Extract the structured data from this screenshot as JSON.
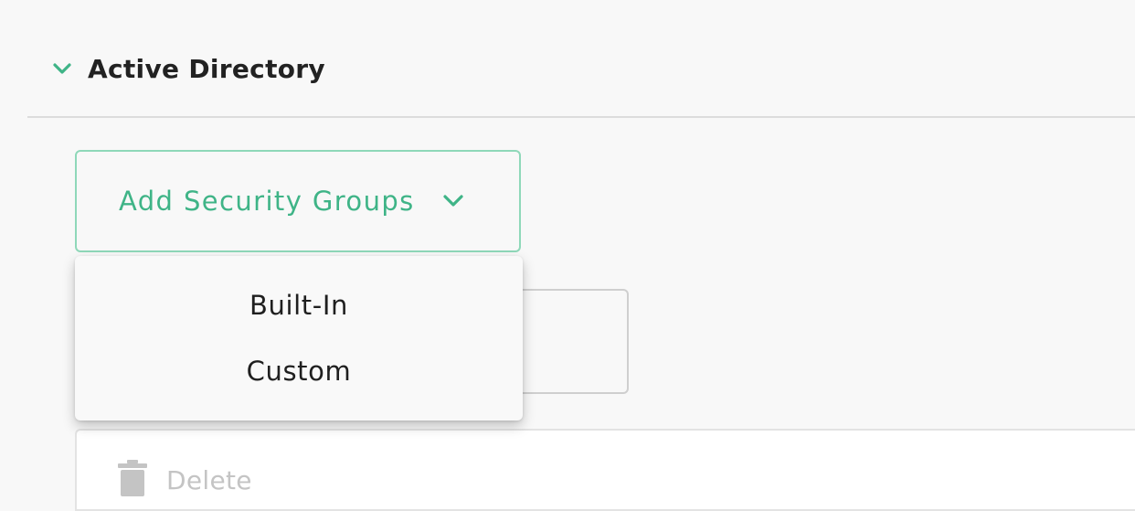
{
  "section": {
    "title": "Active Directory",
    "expand_icon": "chevron-down-icon",
    "icon_color": "#3fb487"
  },
  "add_groups": {
    "label": "Add Security Groups",
    "dropdown_icon": "chevron-down-icon",
    "accent": "#3fb487",
    "border_color": "#8fd8b9"
  },
  "dropdown": {
    "items": [
      {
        "label": "Built-In"
      },
      {
        "label": "Custom"
      }
    ]
  },
  "actions": {
    "delete_label": "Delete",
    "delete_icon": "trash-icon",
    "disabled_color": "#c4c4c4"
  }
}
